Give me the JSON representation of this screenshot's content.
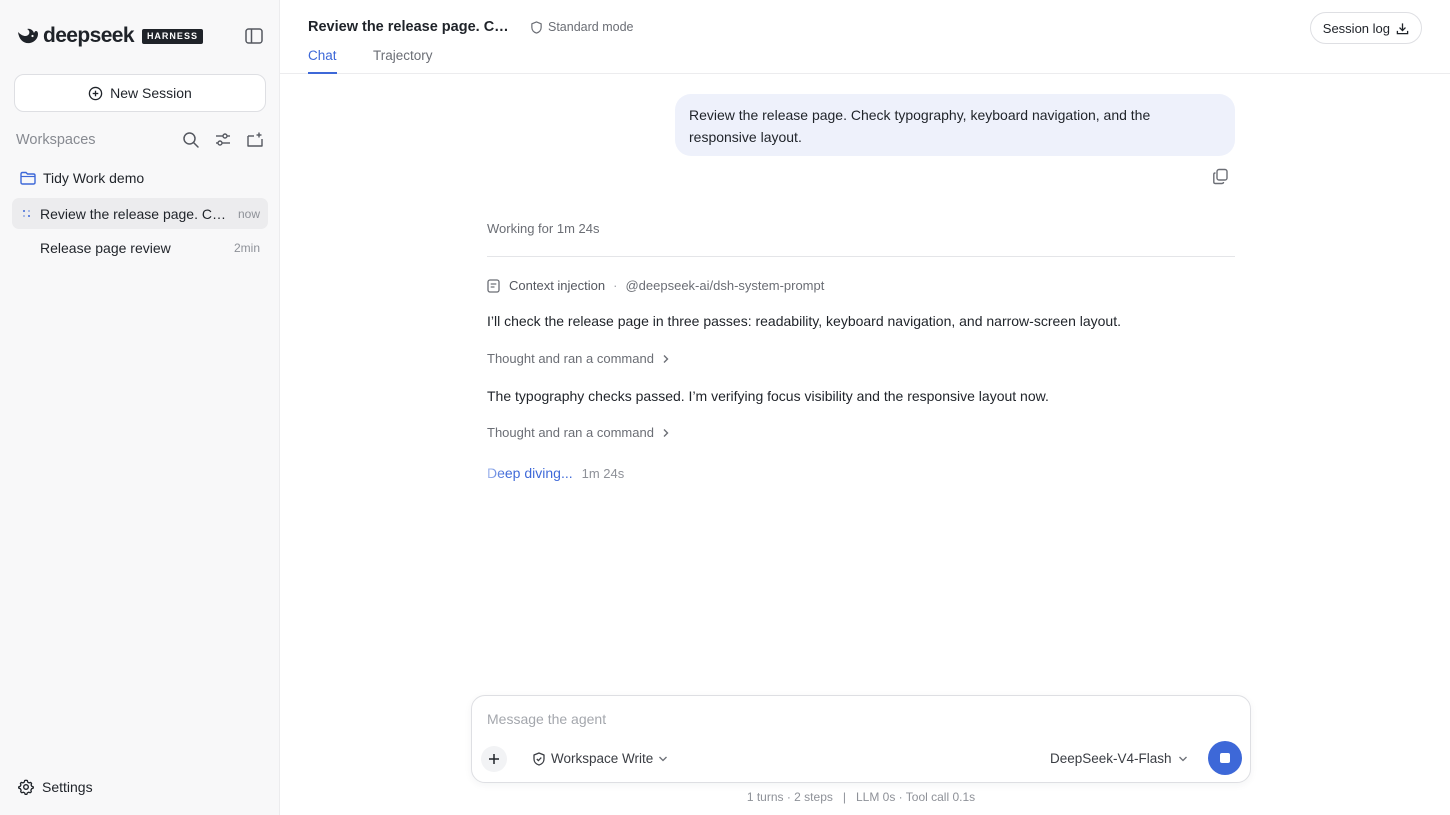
{
  "brand": {
    "name": "deepseek",
    "badge": "HARNESS"
  },
  "sidebar": {
    "new_session_label": "New Session",
    "workspaces_label": "Workspaces",
    "workspace": {
      "name": "Tidy Work demo"
    },
    "sessions": [
      {
        "title": "Review the release page. Check typography, keyboard navigation, and the responsive layout.",
        "time": "now",
        "active": true
      },
      {
        "title": "Release page review",
        "time": "2min",
        "active": false
      }
    ],
    "settings_label": "Settings"
  },
  "header": {
    "title": "Review the release page. Check typography, keyboard navigation, and the responsive layout.",
    "mode": "Standard mode",
    "session_log_label": "Session log",
    "tabs": [
      {
        "label": "Chat",
        "active": true
      },
      {
        "label": "Trajectory",
        "active": false
      }
    ]
  },
  "conversation": {
    "user_message": "Review the release page. Check typography, keyboard navigation, and the responsive layout.",
    "working": "Working for 1m 24s",
    "context_label": "Context injection",
    "context_separator": "·",
    "context_source": "@deepseek-ai/dsh-system-prompt",
    "messages": [
      "I’ll check the release page in three passes: readability, keyboard navigation, and narrow-screen layout.",
      "The typography checks passed. I’m verifying focus visibility and the responsive layout now."
    ],
    "thought_label": "Thought and ran a command",
    "status": {
      "label": "Deep diving...",
      "elapsed": "1m 24s"
    }
  },
  "composer": {
    "placeholder": "Message the agent",
    "value": "",
    "permission": "Workspace Write",
    "model": "DeepSeek-V4-Flash"
  },
  "stats": "1 turns · 2 steps   |   LLM 0s · Tool call 0.1s",
  "colors": {
    "accent": "#3d68d8",
    "bubble": "#eef1fb",
    "sidebar_bg": "#f8f8f9",
    "active_row": "#ececee"
  }
}
